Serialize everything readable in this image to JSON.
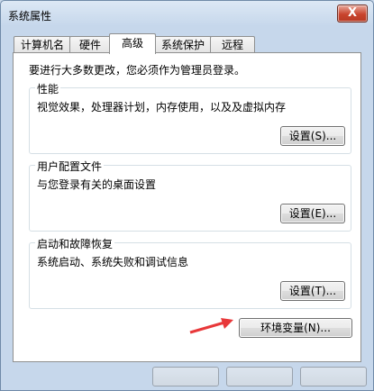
{
  "window": {
    "title": "系统属性",
    "close_label": "X"
  },
  "tabs": [
    {
      "label": "计算机名",
      "active": false
    },
    {
      "label": "硬件",
      "active": false
    },
    {
      "label": "高级",
      "active": true
    },
    {
      "label": "系统保护",
      "active": false
    },
    {
      "label": "远程",
      "active": false
    }
  ],
  "intro": "要进行大多数更改，您必须作为管理员登录。",
  "performance": {
    "title": "性能",
    "description": "视觉效果，处理器计划，内存使用，以及及虚拟内存",
    "button": "设置(S)..."
  },
  "user_profiles": {
    "title": "用户配置文件",
    "description": "与您登录有关的桌面设置",
    "button": "设置(E)..."
  },
  "startup_recovery": {
    "title": "启动和故障恢复",
    "description": "系统启动、系统失败和调试信息",
    "button": "设置(T)..."
  },
  "env_button": "环境变量(N)...",
  "annotation_arrow_color": "#e8383a"
}
